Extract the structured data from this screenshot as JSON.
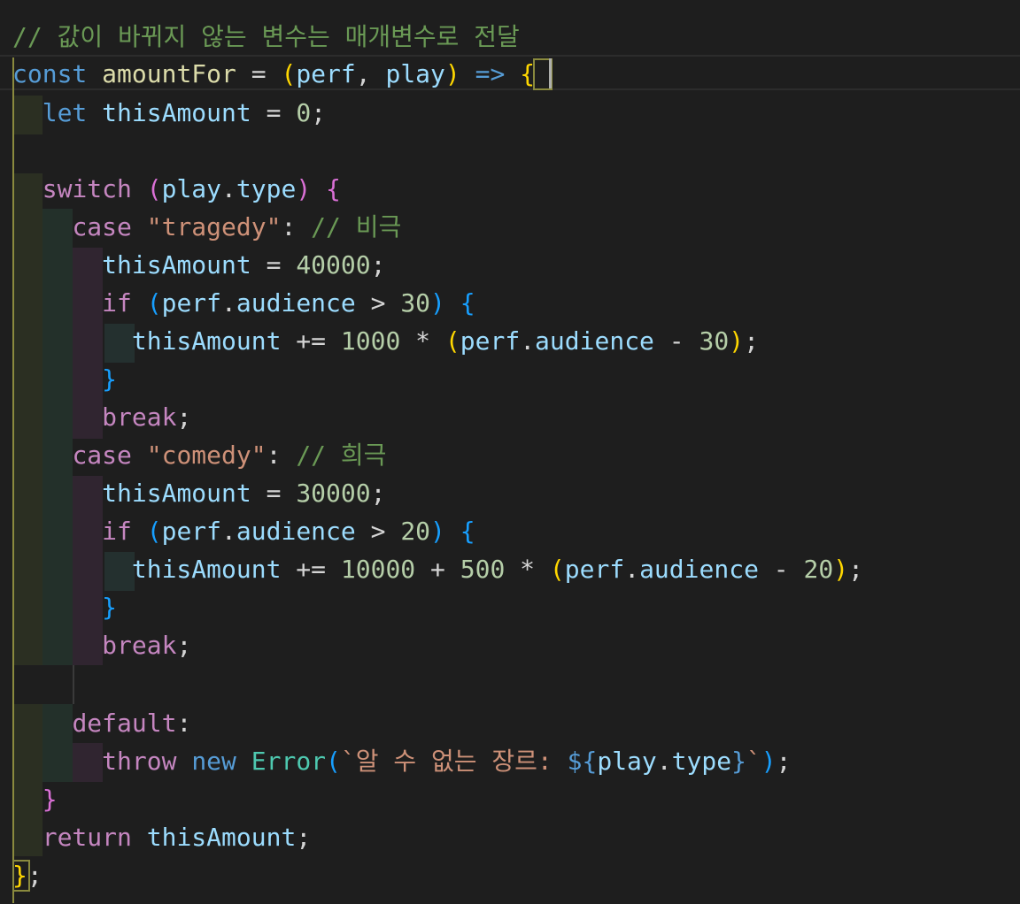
{
  "editor": {
    "lines": [
      [
        {
          "t": "// 값이 바뀌지 않는 변수는 매개변수로 전달",
          "c": "cmt"
        }
      ],
      [
        {
          "t": "const",
          "c": "kw"
        },
        {
          "t": " ",
          "c": "plain"
        },
        {
          "t": "amountFor",
          "c": "fn"
        },
        {
          "t": " = ",
          "c": "plain"
        },
        {
          "t": "(",
          "c": "br1"
        },
        {
          "t": "perf",
          "c": "var"
        },
        {
          "t": ", ",
          "c": "plain"
        },
        {
          "t": "play",
          "c": "var"
        },
        {
          "t": ")",
          "c": "br1"
        },
        {
          "t": " ",
          "c": "plain"
        },
        {
          "t": "=>",
          "c": "kw"
        },
        {
          "t": " ",
          "c": "plain"
        },
        {
          "t": "{",
          "c": "br1"
        }
      ],
      [
        {
          "t": "  ",
          "c": "plain"
        },
        {
          "t": "let",
          "c": "kw"
        },
        {
          "t": " ",
          "c": "plain"
        },
        {
          "t": "thisAmount",
          "c": "var"
        },
        {
          "t": " = ",
          "c": "plain"
        },
        {
          "t": "0",
          "c": "num"
        },
        {
          "t": ";",
          "c": "plain"
        }
      ],
      [],
      [
        {
          "t": "  ",
          "c": "plain"
        },
        {
          "t": "switch",
          "c": "ctl"
        },
        {
          "t": " ",
          "c": "plain"
        },
        {
          "t": "(",
          "c": "br2"
        },
        {
          "t": "play",
          "c": "var"
        },
        {
          "t": ".",
          "c": "plain"
        },
        {
          "t": "type",
          "c": "var"
        },
        {
          "t": ")",
          "c": "br2"
        },
        {
          "t": " ",
          "c": "plain"
        },
        {
          "t": "{",
          "c": "br2"
        }
      ],
      [
        {
          "t": "    ",
          "c": "plain"
        },
        {
          "t": "case",
          "c": "ctl"
        },
        {
          "t": " ",
          "c": "plain"
        },
        {
          "t": "\"tragedy\"",
          "c": "str"
        },
        {
          "t": ": ",
          "c": "plain"
        },
        {
          "t": "// 비극",
          "c": "cmt"
        }
      ],
      [
        {
          "t": "      ",
          "c": "plain"
        },
        {
          "t": "thisAmount",
          "c": "var"
        },
        {
          "t": " = ",
          "c": "plain"
        },
        {
          "t": "40000",
          "c": "num"
        },
        {
          "t": ";",
          "c": "plain"
        }
      ],
      [
        {
          "t": "      ",
          "c": "plain"
        },
        {
          "t": "if",
          "c": "ctl"
        },
        {
          "t": " ",
          "c": "plain"
        },
        {
          "t": "(",
          "c": "br3"
        },
        {
          "t": "perf",
          "c": "var"
        },
        {
          "t": ".",
          "c": "plain"
        },
        {
          "t": "audience",
          "c": "var"
        },
        {
          "t": " > ",
          "c": "plain"
        },
        {
          "t": "30",
          "c": "num"
        },
        {
          "t": ")",
          "c": "br3"
        },
        {
          "t": " ",
          "c": "plain"
        },
        {
          "t": "{",
          "c": "br3"
        }
      ],
      [
        {
          "t": "        ",
          "c": "plain"
        },
        {
          "t": "thisAmount",
          "c": "var"
        },
        {
          "t": " += ",
          "c": "plain"
        },
        {
          "t": "1000",
          "c": "num"
        },
        {
          "t": " * ",
          "c": "plain"
        },
        {
          "t": "(",
          "c": "br1"
        },
        {
          "t": "perf",
          "c": "var"
        },
        {
          "t": ".",
          "c": "plain"
        },
        {
          "t": "audience",
          "c": "var"
        },
        {
          "t": " - ",
          "c": "plain"
        },
        {
          "t": "30",
          "c": "num"
        },
        {
          "t": ")",
          "c": "br1"
        },
        {
          "t": ";",
          "c": "plain"
        }
      ],
      [
        {
          "t": "      ",
          "c": "plain"
        },
        {
          "t": "}",
          "c": "br3"
        }
      ],
      [
        {
          "t": "      ",
          "c": "plain"
        },
        {
          "t": "break",
          "c": "ctl"
        },
        {
          "t": ";",
          "c": "plain"
        }
      ],
      [
        {
          "t": "    ",
          "c": "plain"
        },
        {
          "t": "case",
          "c": "ctl"
        },
        {
          "t": " ",
          "c": "plain"
        },
        {
          "t": "\"comedy\"",
          "c": "str"
        },
        {
          "t": ": ",
          "c": "plain"
        },
        {
          "t": "// 희극",
          "c": "cmt"
        }
      ],
      [
        {
          "t": "      ",
          "c": "plain"
        },
        {
          "t": "thisAmount",
          "c": "var"
        },
        {
          "t": " = ",
          "c": "plain"
        },
        {
          "t": "30000",
          "c": "num"
        },
        {
          "t": ";",
          "c": "plain"
        }
      ],
      [
        {
          "t": "      ",
          "c": "plain"
        },
        {
          "t": "if",
          "c": "ctl"
        },
        {
          "t": " ",
          "c": "plain"
        },
        {
          "t": "(",
          "c": "br3"
        },
        {
          "t": "perf",
          "c": "var"
        },
        {
          "t": ".",
          "c": "plain"
        },
        {
          "t": "audience",
          "c": "var"
        },
        {
          "t": " > ",
          "c": "plain"
        },
        {
          "t": "20",
          "c": "num"
        },
        {
          "t": ")",
          "c": "br3"
        },
        {
          "t": " ",
          "c": "plain"
        },
        {
          "t": "{",
          "c": "br3"
        }
      ],
      [
        {
          "t": "        ",
          "c": "plain"
        },
        {
          "t": "thisAmount",
          "c": "var"
        },
        {
          "t": " += ",
          "c": "plain"
        },
        {
          "t": "10000",
          "c": "num"
        },
        {
          "t": " + ",
          "c": "plain"
        },
        {
          "t": "500",
          "c": "num"
        },
        {
          "t": " * ",
          "c": "plain"
        },
        {
          "t": "(",
          "c": "br1"
        },
        {
          "t": "perf",
          "c": "var"
        },
        {
          "t": ".",
          "c": "plain"
        },
        {
          "t": "audience",
          "c": "var"
        },
        {
          "t": " - ",
          "c": "plain"
        },
        {
          "t": "20",
          "c": "num"
        },
        {
          "t": ")",
          "c": "br1"
        },
        {
          "t": ";",
          "c": "plain"
        }
      ],
      [
        {
          "t": "      ",
          "c": "plain"
        },
        {
          "t": "}",
          "c": "br3"
        }
      ],
      [
        {
          "t": "      ",
          "c": "plain"
        },
        {
          "t": "break",
          "c": "ctl"
        },
        {
          "t": ";",
          "c": "plain"
        }
      ],
      [],
      [
        {
          "t": "    ",
          "c": "plain"
        },
        {
          "t": "default",
          "c": "ctl"
        },
        {
          "t": ":",
          "c": "plain"
        }
      ],
      [
        {
          "t": "      ",
          "c": "plain"
        },
        {
          "t": "throw",
          "c": "ctl"
        },
        {
          "t": " ",
          "c": "plain"
        },
        {
          "t": "new",
          "c": "kw"
        },
        {
          "t": " ",
          "c": "plain"
        },
        {
          "t": "Error",
          "c": "cls"
        },
        {
          "t": "(",
          "c": "br3"
        },
        {
          "t": "`알 수 없는 장르: ",
          "c": "str"
        },
        {
          "t": "${",
          "c": "tmpl"
        },
        {
          "t": "play",
          "c": "var"
        },
        {
          "t": ".",
          "c": "plain"
        },
        {
          "t": "type",
          "c": "var"
        },
        {
          "t": "}",
          "c": "tmpl"
        },
        {
          "t": "`",
          "c": "str"
        },
        {
          "t": ")",
          "c": "br3"
        },
        {
          "t": ";",
          "c": "plain"
        }
      ],
      [
        {
          "t": "  ",
          "c": "plain"
        },
        {
          "t": "}",
          "c": "br2"
        }
      ],
      [
        {
          "t": "  ",
          "c": "plain"
        },
        {
          "t": "return",
          "c": "ctl"
        },
        {
          "t": " ",
          "c": "plain"
        },
        {
          "t": "thisAmount",
          "c": "var"
        },
        {
          "t": ";",
          "c": "plain"
        }
      ],
      [
        {
          "t": "}",
          "c": "br1"
        },
        {
          "t": ";",
          "c": "plain"
        }
      ]
    ]
  }
}
